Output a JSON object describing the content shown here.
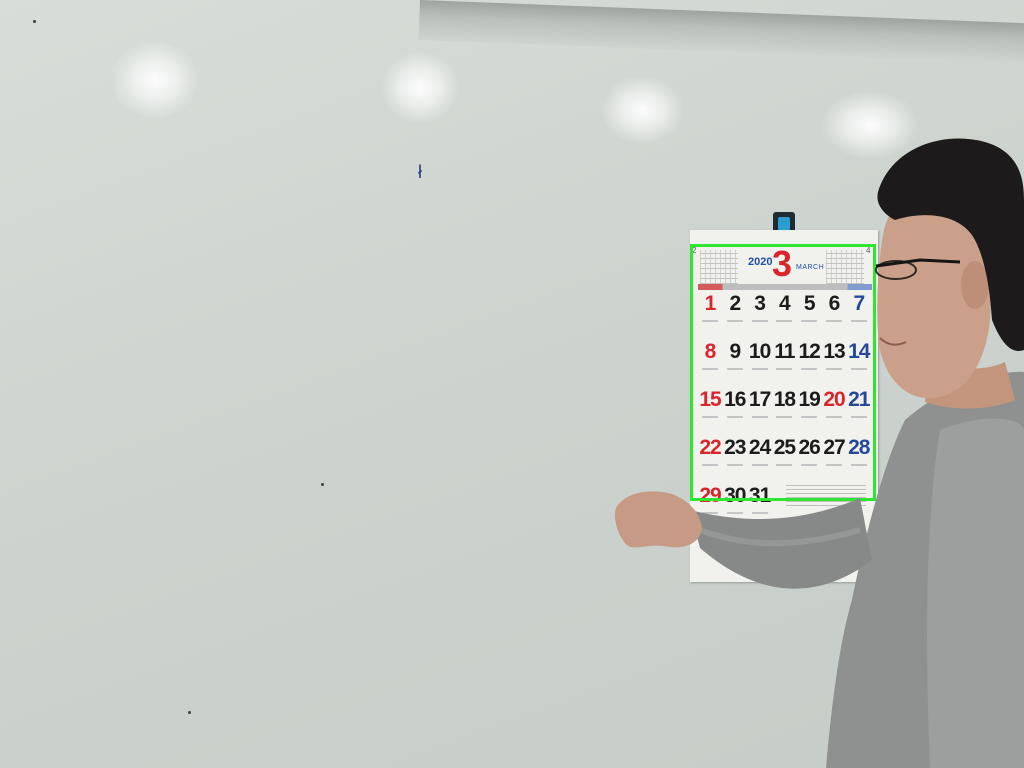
{
  "calendar": {
    "year": "2020",
    "month_number": "3",
    "month_name": "MARCH",
    "mini_prev": "2",
    "mini_next": "4",
    "days": [
      {
        "n": "1",
        "c": "red"
      },
      {
        "n": "2",
        "c": "black"
      },
      {
        "n": "3",
        "c": "black"
      },
      {
        "n": "4",
        "c": "black"
      },
      {
        "n": "5",
        "c": "black"
      },
      {
        "n": "6",
        "c": "black"
      },
      {
        "n": "7",
        "c": "blue"
      },
      {
        "n": "8",
        "c": "red"
      },
      {
        "n": "9",
        "c": "black"
      },
      {
        "n": "10",
        "c": "black"
      },
      {
        "n": "11",
        "c": "black"
      },
      {
        "n": "12",
        "c": "black"
      },
      {
        "n": "13",
        "c": "black"
      },
      {
        "n": "14",
        "c": "blue"
      },
      {
        "n": "15",
        "c": "red"
      },
      {
        "n": "16",
        "c": "black"
      },
      {
        "n": "17",
        "c": "black"
      },
      {
        "n": "18",
        "c": "black"
      },
      {
        "n": "19",
        "c": "black"
      },
      {
        "n": "20",
        "c": "red"
      },
      {
        "n": "21",
        "c": "blue"
      },
      {
        "n": "22",
        "c": "red"
      },
      {
        "n": "23",
        "c": "black"
      },
      {
        "n": "24",
        "c": "black"
      },
      {
        "n": "25",
        "c": "black"
      },
      {
        "n": "26",
        "c": "black"
      },
      {
        "n": "27",
        "c": "black"
      },
      {
        "n": "28",
        "c": "blue"
      },
      {
        "n": "29",
        "c": "red"
      },
      {
        "n": "30",
        "c": "black"
      },
      {
        "n": "31",
        "c": "black"
      }
    ]
  },
  "colors": {
    "detection_box": "#2ee62e",
    "sunday_red": "#d8262b",
    "saturday_blue": "#24499b",
    "sweater_gray": "#8e918f",
    "hair": "#1c1a1a"
  }
}
